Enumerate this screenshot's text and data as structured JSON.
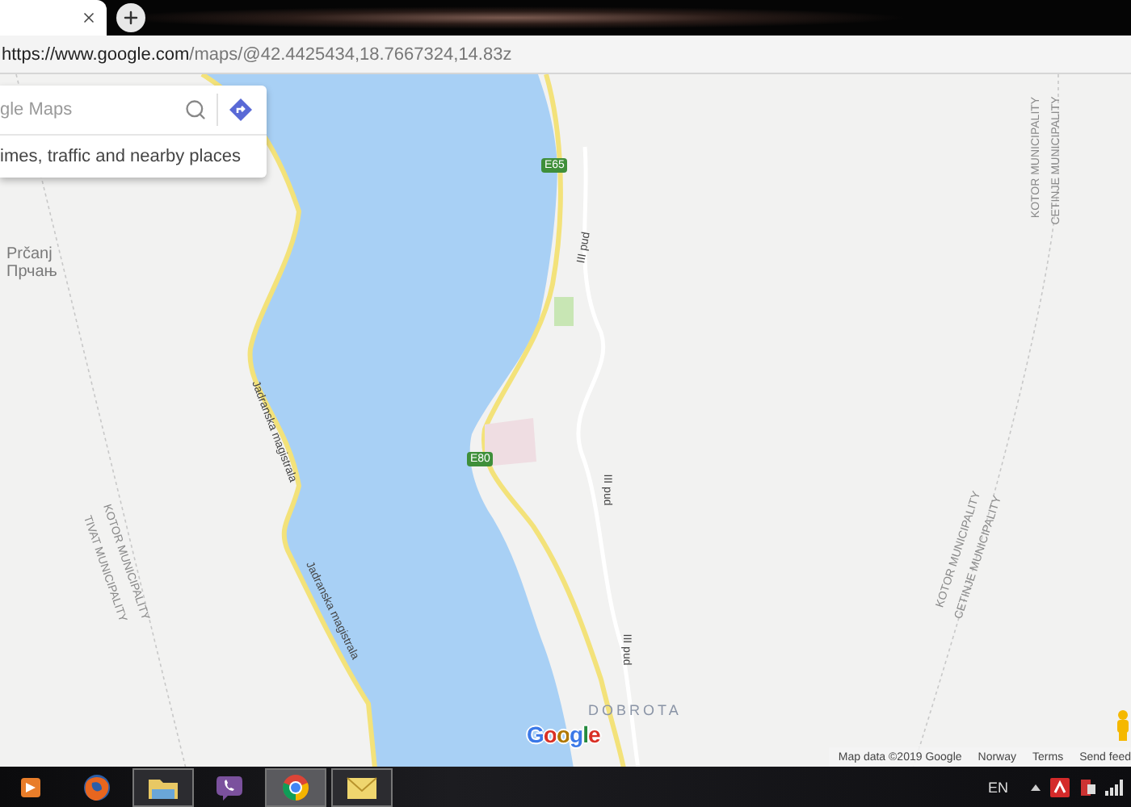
{
  "browser": {
    "address_bar": {
      "host": "https://www.google.com",
      "path": "/maps/@42.4425434,18.7667324,14.83z"
    }
  },
  "search": {
    "placeholder": "gle Maps",
    "hint": "imes, traffic and nearby places"
  },
  "map": {
    "labels": [
      {
        "kind": "place",
        "text": "Prčanj"
      },
      {
        "kind": "place",
        "text": "Прчањ"
      },
      {
        "kind": "road",
        "text": "Jadranska magistrala"
      },
      {
        "kind": "road",
        "text": "Jadranska magistrala"
      },
      {
        "kind": "boundary",
        "text": "KOTOR MUNICIPALITY"
      },
      {
        "kind": "boundary",
        "text": "TIVAT MUNICIPALITY"
      },
      {
        "kind": "road",
        "text": "III pud"
      },
      {
        "kind": "road",
        "text": "III pud"
      },
      {
        "kind": "road",
        "text": "III pud"
      },
      {
        "kind": "boundary",
        "text": "KOTOR MUNICIPALITY"
      },
      {
        "kind": "boundary",
        "text": "CETINJE MUNICIPALITY"
      },
      {
        "kind": "boundary",
        "text": "KOTOR MUNICIPALITY"
      },
      {
        "kind": "boundary",
        "text": "CETINJE MUNICIPALITY"
      },
      {
        "kind": "district",
        "text": "DOBROTA"
      },
      {
        "kind": "shield",
        "text": "E65"
      },
      {
        "kind": "shield",
        "text": "E80"
      }
    ],
    "logo": "Google",
    "footer": [
      "Map data ©2019 Google",
      "Norway",
      "Terms",
      "Send feed"
    ]
  },
  "taskbar": {
    "apps": [
      {
        "kind": "media",
        "running": false,
        "selected": false
      },
      {
        "kind": "firefox",
        "running": false,
        "selected": false
      },
      {
        "kind": "folder",
        "running": true,
        "selected": false
      },
      {
        "kind": "viber",
        "running": false,
        "selected": false
      },
      {
        "kind": "chrome",
        "running": true,
        "selected": true
      },
      {
        "kind": "mail",
        "running": true,
        "selected": false
      }
    ],
    "language": "EN"
  }
}
